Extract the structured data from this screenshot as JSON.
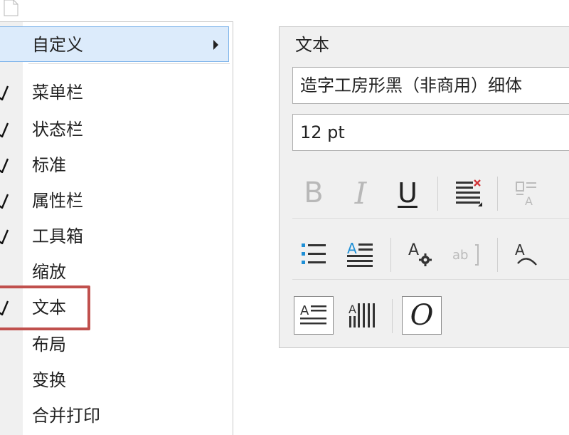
{
  "menu": {
    "customize": {
      "label": "自定义"
    },
    "items": [
      {
        "label": "菜单栏",
        "checked": true
      },
      {
        "label": "状态栏",
        "checked": true
      },
      {
        "label": "标准",
        "checked": true
      },
      {
        "label": "属性栏",
        "checked": true
      },
      {
        "label": "工具箱",
        "checked": true
      },
      {
        "label": "缩放",
        "checked": false
      },
      {
        "label": "文本",
        "checked": true
      },
      {
        "label": "布局",
        "checked": false
      },
      {
        "label": "变换",
        "checked": false
      },
      {
        "label": "合并打印",
        "checked": false
      }
    ]
  },
  "panel": {
    "title": "文本",
    "font_name": "造字工房形黑（非商用）细体",
    "font_size": "12 pt",
    "buttons": {
      "bold": "B",
      "italic": "I",
      "underline": "U",
      "italic_O": "O"
    }
  },
  "colors": {
    "highlight_bg": "#dcebfb",
    "highlight_border": "#7eb4ea",
    "focus_box": "#c0504d",
    "accent_blue": "#1e8fd6",
    "disabled": "#b8b8b8"
  }
}
